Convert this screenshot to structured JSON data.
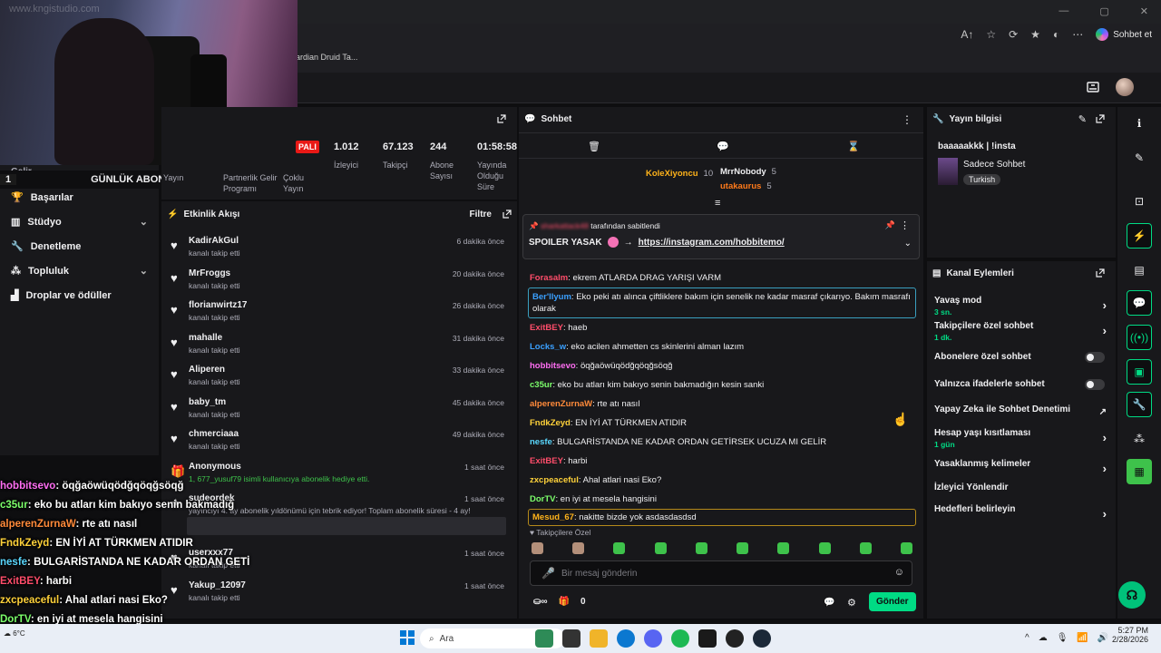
{
  "browser": {
    "window_controls": [
      "—",
      "▢",
      "✕"
    ],
    "address_icons": [
      "A↑",
      "☆",
      "⟳",
      "★",
      "◐",
      "⋯"
    ],
    "copilot_label": "Sohbet et",
    "bookmark": "ardian Druid Ta..."
  },
  "camera": {
    "watermark": "www.kngistudio.com"
  },
  "daily_sub": {
    "count_left": "1",
    "label": "GÜNLÜK ABONE",
    "count_right": "10"
  },
  "sidebar": {
    "partial_label": "Gelir",
    "items": [
      {
        "label": "Başarılar",
        "icon": "trophy-icon",
        "chev": ""
      },
      {
        "label": "Stüdyo",
        "icon": "studio-icon",
        "chev": "⌄"
      },
      {
        "label": "Denetleme",
        "icon": "wrench-icon",
        "chev": ""
      },
      {
        "label": "Topluluk",
        "icon": "community-icon",
        "chev": "⌄"
      },
      {
        "label": "Droplar ve ödüller",
        "icon": "drops-icon",
        "chev": ""
      }
    ]
  },
  "stats": {
    "live": "PALI",
    "items": [
      {
        "value": "1.012",
        "label": "İzleyici"
      },
      {
        "value": "67.123",
        "label": "Takipçi"
      },
      {
        "value": "244",
        "label": "Abone Sayısı"
      },
      {
        "value": "01:58:58",
        "label": "Yayında Olduğu Süre"
      }
    ],
    "partial": [
      {
        "label": "Yayın"
      },
      {
        "label": "Partnerlik Gelir Programı"
      },
      {
        "label": "Çoklu Yayın"
      }
    ]
  },
  "activity": {
    "title": "Etkinlik Akışı",
    "filter": "Filtre",
    "items": [
      {
        "name": "KadirAkGul",
        "desc": "kanalı takip etti",
        "time": "6 dakika önce"
      },
      {
        "name": "MrFroggs",
        "desc": "kanalı takip etti",
        "time": "20 dakika önce"
      },
      {
        "name": "florianwirtz17",
        "desc": "kanalı takip etti",
        "time": "26 dakika önce"
      },
      {
        "name": "mahalle",
        "desc": "kanalı takip etti",
        "time": "31 dakika önce"
      },
      {
        "name": "Aliperen",
        "desc": "kanalı takip etti",
        "time": "33 dakika önce"
      },
      {
        "name": "baby_tm",
        "desc": "kanalı takip etti",
        "time": "45 dakika önce"
      },
      {
        "name": "chmerciaaa",
        "desc": "kanalı takip etti",
        "time": "49 dakika önce"
      },
      {
        "name": "Anonymous",
        "desc": "1, 677_yusuf79 isimli kullanıcıya abonelik hediye etti.",
        "time": "1 saat önce"
      },
      {
        "name": "sudeordek",
        "desc": "yayıncıyı 4. ay abonelik yıldönümü için tebrik ediyor! Toplam abonelik süresi - 4 ay!",
        "time": "1 saat önce"
      },
      {
        "name": "userxxx77",
        "desc": "kanalı takip etti",
        "time": "1 saat önce"
      },
      {
        "name": "Yakup_12097",
        "desc": "kanalı takip etti",
        "time": "1 saat önce"
      }
    ]
  },
  "chat": {
    "title": "Sohbet",
    "top_gifters": [
      {
        "name": "KoleXiyoncu",
        "count": "10",
        "color": "#ffb31a"
      },
      {
        "name": "MrrNobody",
        "count": "5",
        "color": "#efeff1"
      },
      {
        "name": "utakaurus",
        "count": "5",
        "color": "#ff7a1a"
      }
    ],
    "pinned": {
      "by": "tarafından sabitlendi",
      "pinner": "sharkattack48",
      "text": "SPOILER YASAK",
      "arrow": "→",
      "link": "https://instagram.com/hobbitemo/"
    },
    "messages": [
      {
        "user": "Forasalm",
        "color": "#ff4d6a",
        "text": "ekrem ATLARDA DRAG YARIŞI VARM"
      },
      {
        "user": "Ber'llyum",
        "color": "#3aa0ff",
        "text": "Eko peki atı alınca çiftliklere bakım için senelik ne kadar masraf çıkarıyo. Bakım masrafı olarak",
        "boxed": true
      },
      {
        "user": "ExitBEY",
        "color": "#ff4d6a",
        "text": "haeb"
      },
      {
        "user": "Locks_w",
        "color": "#3aa0ff",
        "text": "eko acilen ahmetten cs skinlerini alman lazım"
      },
      {
        "user": "hobbitsevo",
        "color": "#ff6ef2",
        "text": "öqğaöwüqödğqöqğsöqğ"
      },
      {
        "user": "c35ur",
        "color": "#7cff6b",
        "text": "eko bu atları kim bakıyo senin bakmadığın kesin sanki"
      },
      {
        "user": "alperenZurnaW",
        "color": "#ff8a3a",
        "text": "rte atı nasıl"
      },
      {
        "user": "FndkZeyd",
        "color": "#ffd23a",
        "text": "EN İYİ AT TÜRKMEN ATIDIR"
      },
      {
        "user": "nesfe",
        "color": "#5ad8ff",
        "text": "BULGARİSTANDA NE KADAR ORDAN GETİRSEK UCUZA MI GELİR"
      },
      {
        "user": "ExitBEY",
        "color": "#ff4d6a",
        "text": "harbi"
      },
      {
        "user": "zxcpeaceful",
        "color": "#ffd23a",
        "text": "Ahal atlari nasi Eko?"
      },
      {
        "user": "DorTV",
        "color": "#7cff6b",
        "text": "en iyi at mesela hangisini"
      },
      {
        "user": "Mesud_67",
        "color": "#ffb31a",
        "text": "nakitte bizde yok asdasdasdsd",
        "gold": true
      }
    ],
    "followers_label": "Takipçilere Özel",
    "input_placeholder": "Bir mesaj gönderin",
    "points": "0",
    "send": "Gönder"
  },
  "stream_info": {
    "title": "Yayın bilgisi",
    "stream_title": "baaaaakkk | !insta",
    "category": "Sadece Sohbet",
    "tag": "Turkish"
  },
  "channel_actions": {
    "title": "Kanal Eylemleri",
    "rows": [
      {
        "label": "Yavaş mod",
        "sub": "3 sn.",
        "kind": "arrow"
      },
      {
        "label": "Takipçilere özel sohbet",
        "sub": "1 dk.",
        "kind": "arrow"
      },
      {
        "label": "Abonelere özel sohbet",
        "sub": "",
        "kind": "toggle"
      },
      {
        "label": "Yalnızca ifadelerle sohbet",
        "sub": "",
        "kind": "toggle"
      },
      {
        "label": "Yapay Zeka ile Sohbet Denetimi",
        "sub": "",
        "kind": "ext"
      },
      {
        "label": "Hesap yaşı kısıtlaması",
        "sub": "1 gün",
        "kind": "arrow"
      },
      {
        "label": "Yasaklanmış kelimeler",
        "sub": "",
        "kind": "arrow"
      },
      {
        "label": "İzleyici Yönlendir",
        "sub": "",
        "kind": "none"
      },
      {
        "label": "Hedefleri belirleyin",
        "sub": "",
        "kind": "arrow"
      }
    ]
  },
  "overlay_chat": [
    {
      "user": "hobbitsevo",
      "color": "#ff6ef2",
      "text": ": öqğaöwüqödğqöqğsöqğ"
    },
    {
      "user": "c35ur",
      "color": "#7cff6b",
      "text": ": eko bu atları kim bakıyo senin bakmadığ"
    },
    {
      "user": "alperenZurnaW",
      "color": "#ff8a3a",
      "text": ": rte atı nasıl"
    },
    {
      "user": "FndkZeyd",
      "color": "#ffd23a",
      "text": ": EN İYİ AT TÜRKMEN ATIDIR"
    },
    {
      "user": "nesfe",
      "color": "#5ad8ff",
      "text": ": BULGARİSTANDA NE KADAR ORDAN GETİ"
    },
    {
      "user": "ExitBEY",
      "color": "#ff4d6a",
      "text": ": harbi"
    },
    {
      "user": "zxcpeaceful",
      "color": "#ffd23a",
      "text": ": Ahal atlari nasi Eko?"
    },
    {
      "user": "DorTV",
      "color": "#7cff6b",
      "text": ": en iyi at mesela hangisini"
    },
    {
      "user": "Mesud_67",
      "color": "#ffb31a",
      "text": ": nakitte bizde yok asdasdasdsd"
    }
  ],
  "taskbar": {
    "search": "Ara",
    "weather": "6°C",
    "time": "5:27 PM",
    "date": "2/28/2026"
  }
}
